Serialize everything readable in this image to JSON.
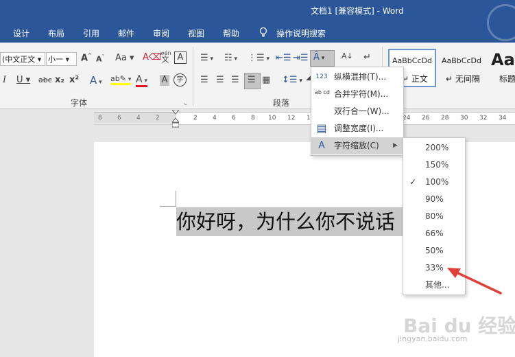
{
  "window": {
    "title": "文档1 [兼容模式]  -  Word"
  },
  "tabs": [
    {
      "label": "设计"
    },
    {
      "label": "布局"
    },
    {
      "label": "引用"
    },
    {
      "label": "邮件"
    },
    {
      "label": "审阅"
    },
    {
      "label": "视图"
    },
    {
      "label": "帮助"
    },
    {
      "label": "操作说明搜索"
    }
  ],
  "ribbon": {
    "font_group": {
      "label": "字体",
      "font_name": "(中文正文",
      "font_size": "小一",
      "change_case": "Aa",
      "phonetic_top": "wén",
      "phonetic_bottom": "文",
      "char_border": "A",
      "italic": "I",
      "underline": "U",
      "strikethrough": "abc",
      "subscript": "x₂",
      "superscript": "x²",
      "text_effects": "A",
      "font_color": "A",
      "char_shading": "A",
      "enclose": "字"
    },
    "paragraph_group": {
      "label": "段落"
    },
    "styles": [
      {
        "preview": "AaBbCcDd",
        "name": "正文"
      },
      {
        "preview": "AaBbCcDd",
        "name": "无间隔"
      },
      {
        "preview": "AaB",
        "name": "标题"
      }
    ]
  },
  "ruler": {
    "left_numbers": [
      "8",
      "6",
      "4",
      "2"
    ],
    "right_numbers": [
      "2",
      "4",
      "6",
      "8",
      "10",
      "12",
      "14",
      "24",
      "26",
      "28",
      "30",
      "32",
      "34"
    ]
  },
  "document": {
    "text": "你好呀，为什么你不说话"
  },
  "menu": {
    "items": [
      {
        "icon": "123",
        "label": "纵横混排(T)...",
        "icon_name": "tate-chu-yoko-icon"
      },
      {
        "icon": "ab cd",
        "label": "合并字符(M)...",
        "icon_name": "combine-characters-icon"
      },
      {
        "icon": "",
        "label": "双行合一(W)...",
        "icon_name": ""
      },
      {
        "icon": "▤",
        "label": "调整宽度(I)...",
        "icon_name": "fit-text-icon"
      },
      {
        "icon": "A",
        "label": "字符缩放(C)",
        "icon_name": "character-scaling-icon",
        "has_submenu": true,
        "highlighted": true
      }
    ]
  },
  "submenu": {
    "items": [
      {
        "label": "200%",
        "checked": false
      },
      {
        "label": "150%",
        "checked": false
      },
      {
        "label": "100%",
        "checked": true
      },
      {
        "label": "90%",
        "checked": false
      },
      {
        "label": "80%",
        "checked": false
      },
      {
        "label": "66%",
        "checked": false
      },
      {
        "label": "50%",
        "checked": false
      },
      {
        "label": "33%",
        "checked": false
      },
      {
        "label": "其他...",
        "checked": false
      }
    ],
    "checkmark": "✓"
  },
  "annotation": {
    "arrow_color": "#e0403a",
    "points_to": "33%"
  },
  "watermark": {
    "logo": "Bai du 经验",
    "url": "jingyan.baidu.com"
  },
  "colors": {
    "brand": "#2b579a",
    "highlight": "#c8c8c8",
    "font_color_underline": "#e81123",
    "highlighter_yellow": "#ffff00"
  }
}
